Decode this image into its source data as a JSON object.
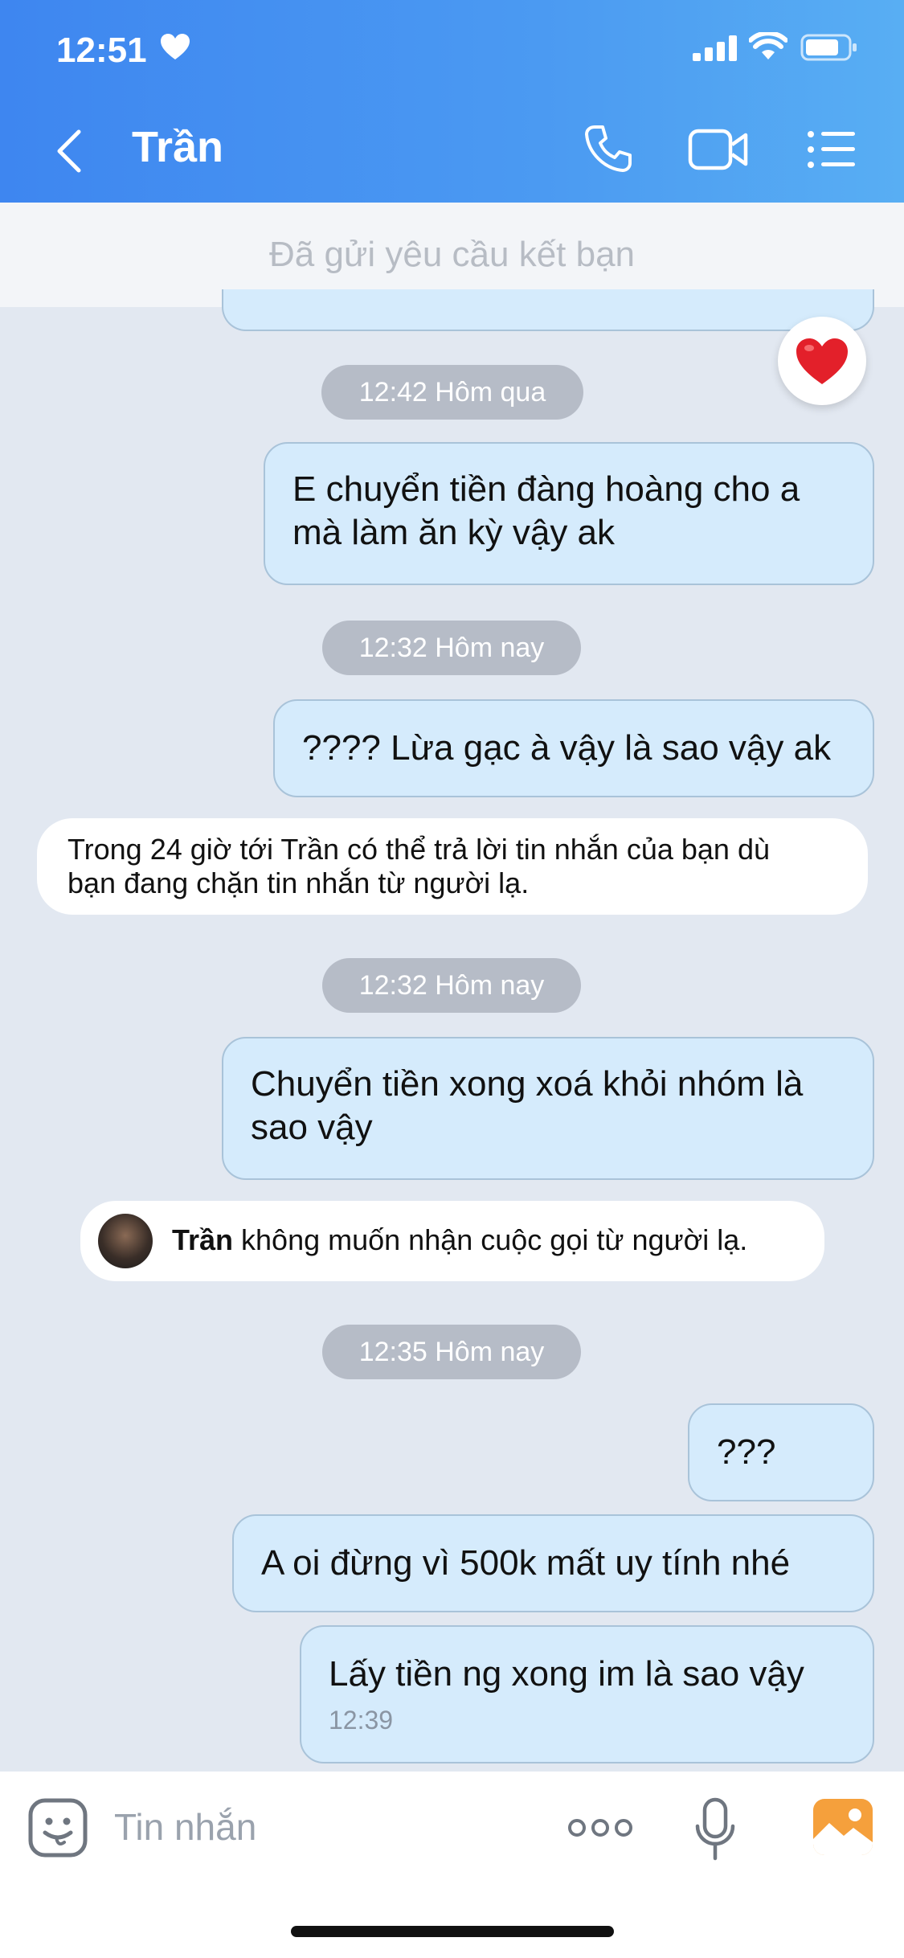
{
  "status": {
    "time": "12:51"
  },
  "header": {
    "title": "Trần"
  },
  "friend_request": "Đã gửi yêu cầu kết bạn",
  "messages": {
    "stamp1": "12:42 Hôm qua",
    "msg1_line1": "E chuyển tiền đàng hoàng cho a",
    "msg1_line2": "mà làm ăn kỳ vậy ak",
    "stamp2": "12:32 Hôm nay",
    "msg2": "???? Lừa gạc à vậy là sao vậy ak",
    "notice1_line1": "Trong 24 giờ tới Trần có thể trả lời tin nhắn của bạn dù",
    "notice1_line2": "bạn đang chặn tin nhắn từ người lạ.",
    "stamp3": "12:32 Hôm nay",
    "msg3_line1": "Chuyển tiền xong xoá khỏi nhóm là",
    "msg3_line2": "sao vậy",
    "notice2_name": "Trần",
    "notice2_text": " không muốn nhận cuộc gọi từ người lạ.",
    "stamp4": "12:35 Hôm nay",
    "msg4": "???",
    "msg5": "A oi đừng vì 500k mất uy tính nhé",
    "msg6": "Lấy tiền ng xong im là sao vậy",
    "msg6_time": "12:39"
  },
  "composer": {
    "placeholder": "Tin nhắn"
  },
  "icons": [
    "heart-icon",
    "signal-icon",
    "wifi-icon",
    "battery-icon",
    "back-icon",
    "phone-icon",
    "video-icon",
    "menu-icon",
    "heart-reaction-icon",
    "emoji-icon",
    "more-icon",
    "mic-icon",
    "image-icon"
  ],
  "colors": {
    "header_start": "#3e86f0",
    "header_end": "#58aef3",
    "bubble": "#d5ebfc",
    "background": "#e2e8f1"
  }
}
